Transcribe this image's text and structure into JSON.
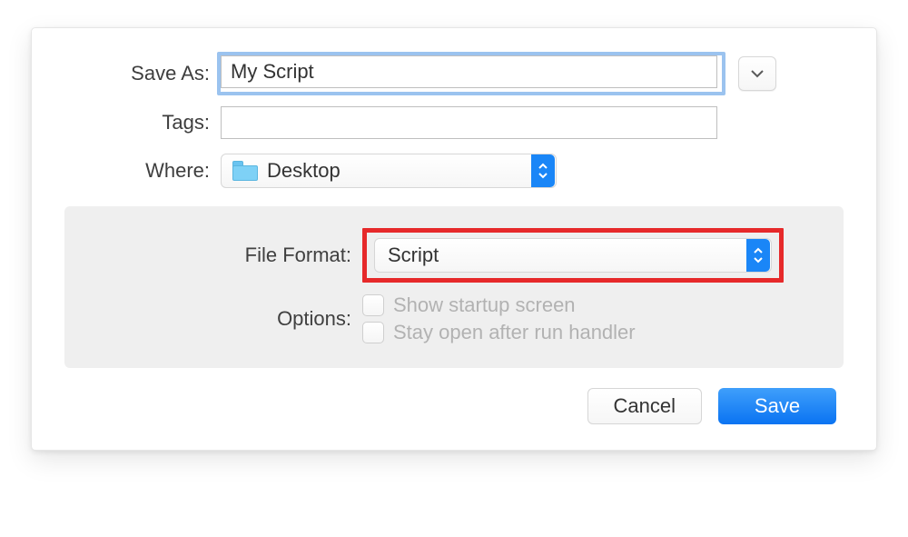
{
  "labels": {
    "save_as": "Save As:",
    "tags": "Tags:",
    "where": "Where:",
    "file_format": "File Format:",
    "options": "Options:"
  },
  "fields": {
    "save_as_value": "My Script",
    "tags_value": "",
    "where_value": "Desktop",
    "file_format_value": "Script"
  },
  "options": {
    "show_startup_screen": "Show startup screen",
    "stay_open": "Stay open after run handler"
  },
  "buttons": {
    "cancel": "Cancel",
    "save": "Save"
  }
}
